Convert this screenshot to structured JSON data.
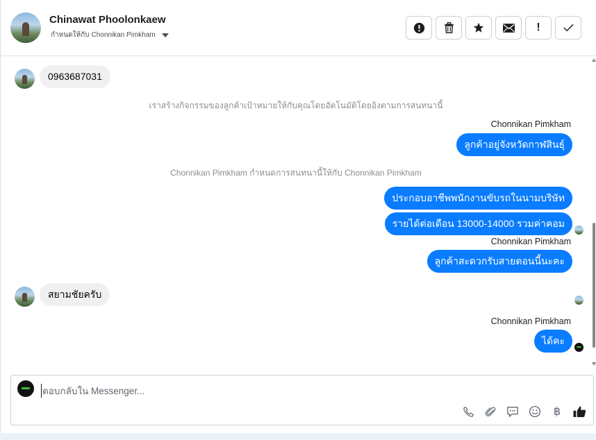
{
  "header": {
    "contact_name": "Chinawat Phoolonkaew",
    "assign_prefix": "กำหนดให้กับ",
    "assignee": "Chonnikan Pimkham",
    "toolbar": [
      {
        "name": "spam-button",
        "icon": "alert-circle-icon"
      },
      {
        "name": "delete-button",
        "icon": "trash-icon"
      },
      {
        "name": "star-button",
        "icon": "star-icon"
      },
      {
        "name": "mark-unread-button",
        "icon": "envelope-icon"
      },
      {
        "name": "follow-up-button",
        "icon": "exclamation-icon",
        "label": "!"
      },
      {
        "name": "mark-done-button",
        "icon": "check-icon"
      }
    ]
  },
  "conversation": {
    "msg_phone": "0963687031",
    "sys_note_1": "เราสร้างกิจกรรมของลูกค้าเป้าหมายให้กับคุณโดยอัตโนมัติโดยอิงตามการสนทนานี้",
    "sender_1": "Chonnikan Pimkham",
    "msg_out_1": "ลูกค้าอยู่จังหวัดกาฬสินธุ์",
    "sys_note_2": "Chonnikan Pimkham กำหนดการสนทนานี้ให้กับ Chonnikan Pimkham",
    "msg_out_2": "ประกอบอาชีพพนักงานขับรถในนามบริษัท",
    "msg_out_3": "รายได้ต่อเดือน 13000-14000 รวมค่าคอม",
    "sender_2": "Chonnikan Pimkham",
    "msg_out_4": "ลูกค้าสะดวกรับสายตอนนี้นะคะ",
    "msg_in_2": "สยามชัยครับ",
    "sender_3": "Chonnikan Pimkham",
    "msg_out_5": "ได้คะ"
  },
  "composer": {
    "placeholder": "ตอบกลับใน Messenger...",
    "value": "",
    "tools": [
      "phone-icon",
      "paperclip-icon",
      "saved-reply-icon",
      "emoji-icon",
      "baht-icon",
      "like-icon"
    ],
    "baht_symbol": "฿"
  },
  "colors": {
    "outgoing_bubble": "#0a7cff",
    "incoming_bubble": "#f0f0f0",
    "system_text": "#8a8d91"
  }
}
